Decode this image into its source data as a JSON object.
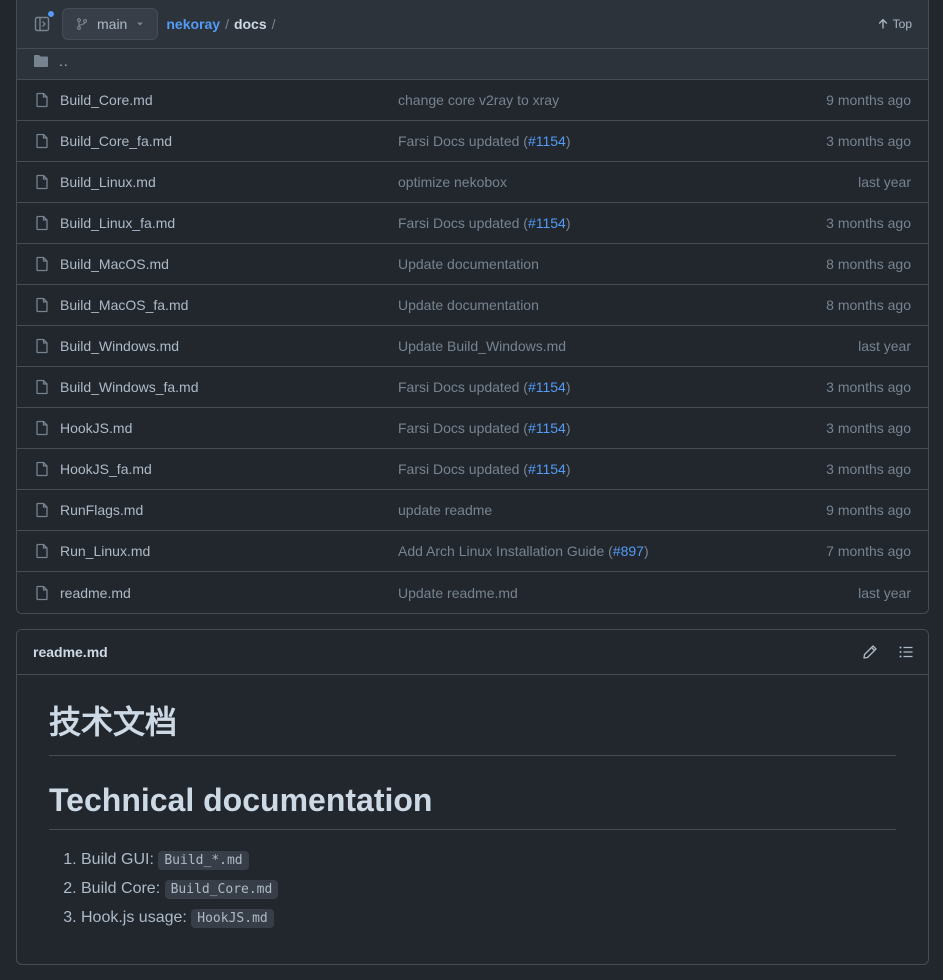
{
  "header": {
    "branch": "main",
    "repo": "nekoray",
    "separator": "/",
    "folder": "docs",
    "trailing_separator": "/",
    "top_label": "Top"
  },
  "parent_row": {
    "label": ".."
  },
  "files": [
    {
      "name": "Build_Core.md",
      "message": "change core v2ray to xray",
      "pr": "",
      "age": "9 months ago"
    },
    {
      "name": "Build_Core_fa.md",
      "message": "Farsi Docs updated (",
      "pr": "#1154",
      "age": "3 months ago"
    },
    {
      "name": "Build_Linux.md",
      "message": "optimize nekobox",
      "pr": "",
      "age": "last year"
    },
    {
      "name": "Build_Linux_fa.md",
      "message": "Farsi Docs updated (",
      "pr": "#1154",
      "age": "3 months ago"
    },
    {
      "name": "Build_MacOS.md",
      "message": "Update documentation",
      "pr": "",
      "age": "8 months ago"
    },
    {
      "name": "Build_MacOS_fa.md",
      "message": "Update documentation",
      "pr": "",
      "age": "8 months ago"
    },
    {
      "name": "Build_Windows.md",
      "message": "Update Build_Windows.md",
      "pr": "",
      "age": "last year"
    },
    {
      "name": "Build_Windows_fa.md",
      "message": "Farsi Docs updated (",
      "pr": "#1154",
      "age": "3 months ago"
    },
    {
      "name": "HookJS.md",
      "message": "Farsi Docs updated (",
      "pr": "#1154",
      "age": "3 months ago"
    },
    {
      "name": "HookJS_fa.md",
      "message": "Farsi Docs updated (",
      "pr": "#1154",
      "age": "3 months ago"
    },
    {
      "name": "RunFlags.md",
      "message": "update readme",
      "pr": "",
      "age": "9 months ago"
    },
    {
      "name": "Run_Linux.md",
      "message": "Add Arch Linux Installation Guide (",
      "pr": "#897",
      "age": "7 months ago"
    },
    {
      "name": "readme.md",
      "message": "Update readme.md",
      "pr": "",
      "age": "last year"
    }
  ],
  "readme": {
    "filename": "readme.md",
    "heading_zh": "技术文档",
    "heading_en": "Technical documentation",
    "items": [
      {
        "label": "Build GUI: ",
        "code": "Build_*.md"
      },
      {
        "label": "Build Core: ",
        "code": "Build_Core.md"
      },
      {
        "label": "Hook.js usage: ",
        "code": "HookJS.md"
      }
    ]
  },
  "colors": {
    "background": "#22272e",
    "surface": "#2d333b",
    "border": "#444c56",
    "link": "#539bf5",
    "muted": "#768390",
    "text": "#adbac7"
  }
}
